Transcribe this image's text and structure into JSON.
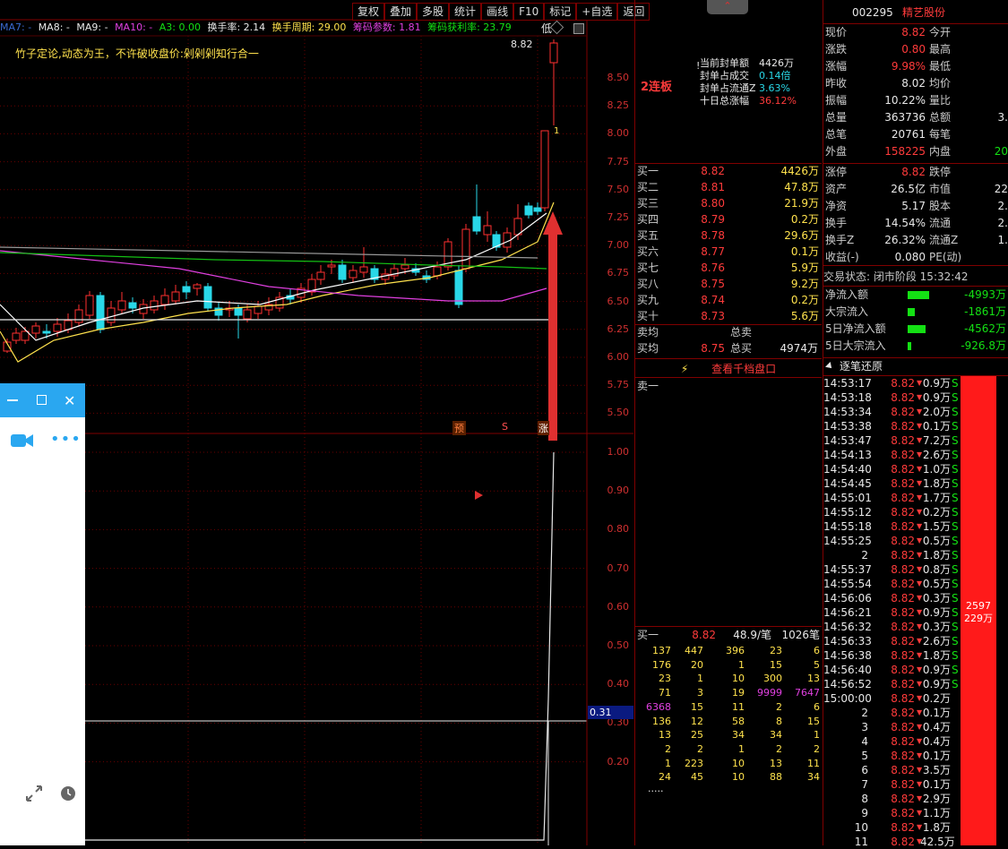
{
  "toolbar": {
    "buttons": [
      "复权",
      "叠加",
      "多股",
      "统计",
      "画线",
      "F10",
      "标记",
      "+自选",
      "返回"
    ]
  },
  "ma_line": {
    "ma7": "MA7: -",
    "ma8": "MA8: -",
    "ma9": "MA9: -",
    "ma10": "MA10: -",
    "a3": "A3: 0.00",
    "turnover_label": "换手率: 2.14",
    "turnover_period": "换手周期: 29.00",
    "chip_param": "筹码参数: 1.81",
    "chip_profit": "筹码获利率: 23.79",
    "low_label": "低"
  },
  "slogan": "竹子定论,动态为王，不许破收盘价:剁剁剁知行合一",
  "price_axis": [
    "8.50",
    "8.25",
    "8.00",
    "7.75",
    "7.50",
    "7.25",
    "7.00",
    "6.75",
    "6.50",
    "6.25",
    "6.00",
    "5.75",
    "5.50"
  ],
  "price_top": "8.82",
  "marker_1": "1",
  "lower_axis": [
    "1.00",
    "0.90",
    "0.80",
    "0.70",
    "0.60",
    "0.50",
    "0.40",
    "0.30",
    "0.20"
  ],
  "lower_current": "0.31",
  "tags": {
    "yu": "预",
    "s": "S",
    "zhang": "涨"
  },
  "mid": {
    "streak": "2连板",
    "seal": [
      {
        "label": "当前封单额",
        "value": "4426万"
      },
      {
        "label": "封单占成交",
        "value": "0.14倍"
      },
      {
        "label": "封单占流通Z",
        "value": "3.63%"
      },
      {
        "label": "十日总涨幅",
        "value": "36.12%"
      }
    ],
    "bids": [
      {
        "label": "买一",
        "price": "8.82",
        "vol": "4426万"
      },
      {
        "label": "买二",
        "price": "8.81",
        "vol": "47.8万"
      },
      {
        "label": "买三",
        "price": "8.80",
        "vol": "21.9万"
      },
      {
        "label": "买四",
        "price": "8.79",
        "vol": "0.2万"
      },
      {
        "label": "买五",
        "price": "8.78",
        "vol": "29.6万"
      },
      {
        "label": "买六",
        "price": "8.77",
        "vol": "0.1万"
      },
      {
        "label": "买七",
        "price": "8.76",
        "vol": "5.9万"
      },
      {
        "label": "买八",
        "price": "8.75",
        "vol": "9.2万"
      },
      {
        "label": "买九",
        "price": "8.74",
        "vol": "0.2万"
      },
      {
        "label": "买十",
        "price": "8.73",
        "vol": "5.6万"
      }
    ],
    "sell_avg": "卖均",
    "total_sell": "总卖",
    "buy_avg": "买均",
    "buy_avg_price": "8.75",
    "total_buy": "总买",
    "total_buy_val": "4974万",
    "depth_link": "查看千档盘口",
    "sell_one": "卖一",
    "queue_head": {
      "label": "买一",
      "price": "8.82",
      "per": "48.9/笔",
      "count": "1026笔"
    },
    "queue": [
      [
        "137",
        "447",
        "396",
        "23",
        "6"
      ],
      [
        "176",
        "20",
        "1",
        "15",
        "5"
      ],
      [
        "23",
        "1",
        "10",
        "300",
        "13"
      ],
      [
        "71",
        "3",
        "19",
        "9999",
        "7647"
      ],
      [
        "6368",
        "15",
        "11",
        "2",
        "6"
      ],
      [
        "136",
        "12",
        "58",
        "8",
        "15"
      ],
      [
        "13",
        "25",
        "34",
        "34",
        "1"
      ],
      [
        "2",
        "2",
        "1",
        "2",
        "2"
      ],
      [
        "1",
        "223",
        "10",
        "13",
        "11"
      ],
      [
        "24",
        "45",
        "10",
        "88",
        "34"
      ]
    ],
    "queue_more": "....."
  },
  "right": {
    "code": "002295",
    "name": "精艺股份",
    "quote": [
      [
        "现价",
        "8.82",
        "今开",
        ""
      ],
      [
        "涨跌",
        "0.80",
        "最高",
        ""
      ],
      [
        "涨幅",
        "9.98%",
        "最低",
        ""
      ],
      [
        "昨收",
        "8.02",
        "均价",
        ""
      ],
      [
        "振幅",
        "10.22%",
        "量比",
        ""
      ],
      [
        "总量",
        "363736",
        "总额",
        "3."
      ],
      [
        "总笔",
        "20761",
        "每笔",
        ""
      ],
      [
        "外盘",
        "158225",
        "内盘",
        "20"
      ],
      [
        "涨停",
        "8.82",
        "跌停",
        ""
      ],
      [
        "资产",
        "26.5亿",
        "市值",
        "22"
      ],
      [
        "净资",
        "5.17",
        "股本",
        "2."
      ],
      [
        "换手",
        "14.54%",
        "流通",
        "2."
      ],
      [
        "换手Z",
        "26.32%",
        "流通Z",
        "1."
      ],
      [
        "收益(-)",
        "0.080",
        "PE(动)",
        ""
      ]
    ],
    "trade_status": "交易状态: 闭市阶段 15:32:42",
    "flows": [
      {
        "label": "净流入额",
        "value": "-4993万"
      },
      {
        "label": "大宗流入",
        "value": "-1861万"
      },
      {
        "label": "5日净流入额",
        "value": "-4562万"
      },
      {
        "label": "5日大宗流入",
        "value": "-926.8万"
      }
    ],
    "ticks_title": "逐笔还原",
    "ticks": [
      [
        "14:53:17",
        "8.82",
        "0.9万",
        "S"
      ],
      [
        "14:53:18",
        "8.82",
        "0.9万",
        "S"
      ],
      [
        "14:53:34",
        "8.82",
        "2.0万",
        "S"
      ],
      [
        "14:53:38",
        "8.82",
        "0.1万",
        "S"
      ],
      [
        "14:53:47",
        "8.82",
        "7.2万",
        "S"
      ],
      [
        "14:54:13",
        "8.82",
        "2.6万",
        "S"
      ],
      [
        "14:54:40",
        "8.82",
        "1.0万",
        "S"
      ],
      [
        "14:54:45",
        "8.82",
        "1.8万",
        "S"
      ],
      [
        "14:55:01",
        "8.82",
        "1.7万",
        "S"
      ],
      [
        "14:55:12",
        "8.82",
        "0.2万",
        "S"
      ],
      [
        "14:55:18",
        "8.82",
        "1.5万",
        "S"
      ],
      [
        "14:55:25",
        "8.82",
        "0.5万",
        "S"
      ],
      [
        "2",
        "8.82",
        "1.8万",
        "S"
      ],
      [
        "14:55:37",
        "8.82",
        "0.8万",
        "S"
      ],
      [
        "14:55:54",
        "8.82",
        "0.5万",
        "S"
      ],
      [
        "14:56:06",
        "8.82",
        "0.3万",
        "S"
      ],
      [
        "14:56:21",
        "8.82",
        "0.9万",
        "S"
      ],
      [
        "14:56:32",
        "8.82",
        "0.3万",
        "S"
      ],
      [
        "14:56:33",
        "8.82",
        "2.6万",
        "S"
      ],
      [
        "14:56:38",
        "8.82",
        "1.8万",
        "S"
      ],
      [
        "14:56:40",
        "8.82",
        "0.9万",
        "S"
      ],
      [
        "14:56:52",
        "8.82",
        "0.9万",
        "S"
      ],
      [
        "15:00:00",
        "8.82",
        "0.2万",
        ""
      ],
      [
        "2",
        "8.82",
        "0.1万",
        ""
      ],
      [
        "3",
        "8.82",
        "0.4万",
        ""
      ],
      [
        "4",
        "8.82",
        "0.4万",
        ""
      ],
      [
        "5",
        "8.82",
        "0.1万",
        ""
      ],
      [
        "6",
        "8.82",
        "3.5万",
        ""
      ],
      [
        "7",
        "8.82",
        "0.1万",
        ""
      ],
      [
        "8",
        "8.82",
        "2.9万",
        ""
      ],
      [
        "9",
        "8.82",
        "1.1万",
        ""
      ],
      [
        "10",
        "8.82",
        "1.8万",
        ""
      ],
      [
        "11",
        "8.82",
        "42.5万",
        ""
      ]
    ],
    "bar_label1": "2597",
    "bar_label2": "229万"
  }
}
